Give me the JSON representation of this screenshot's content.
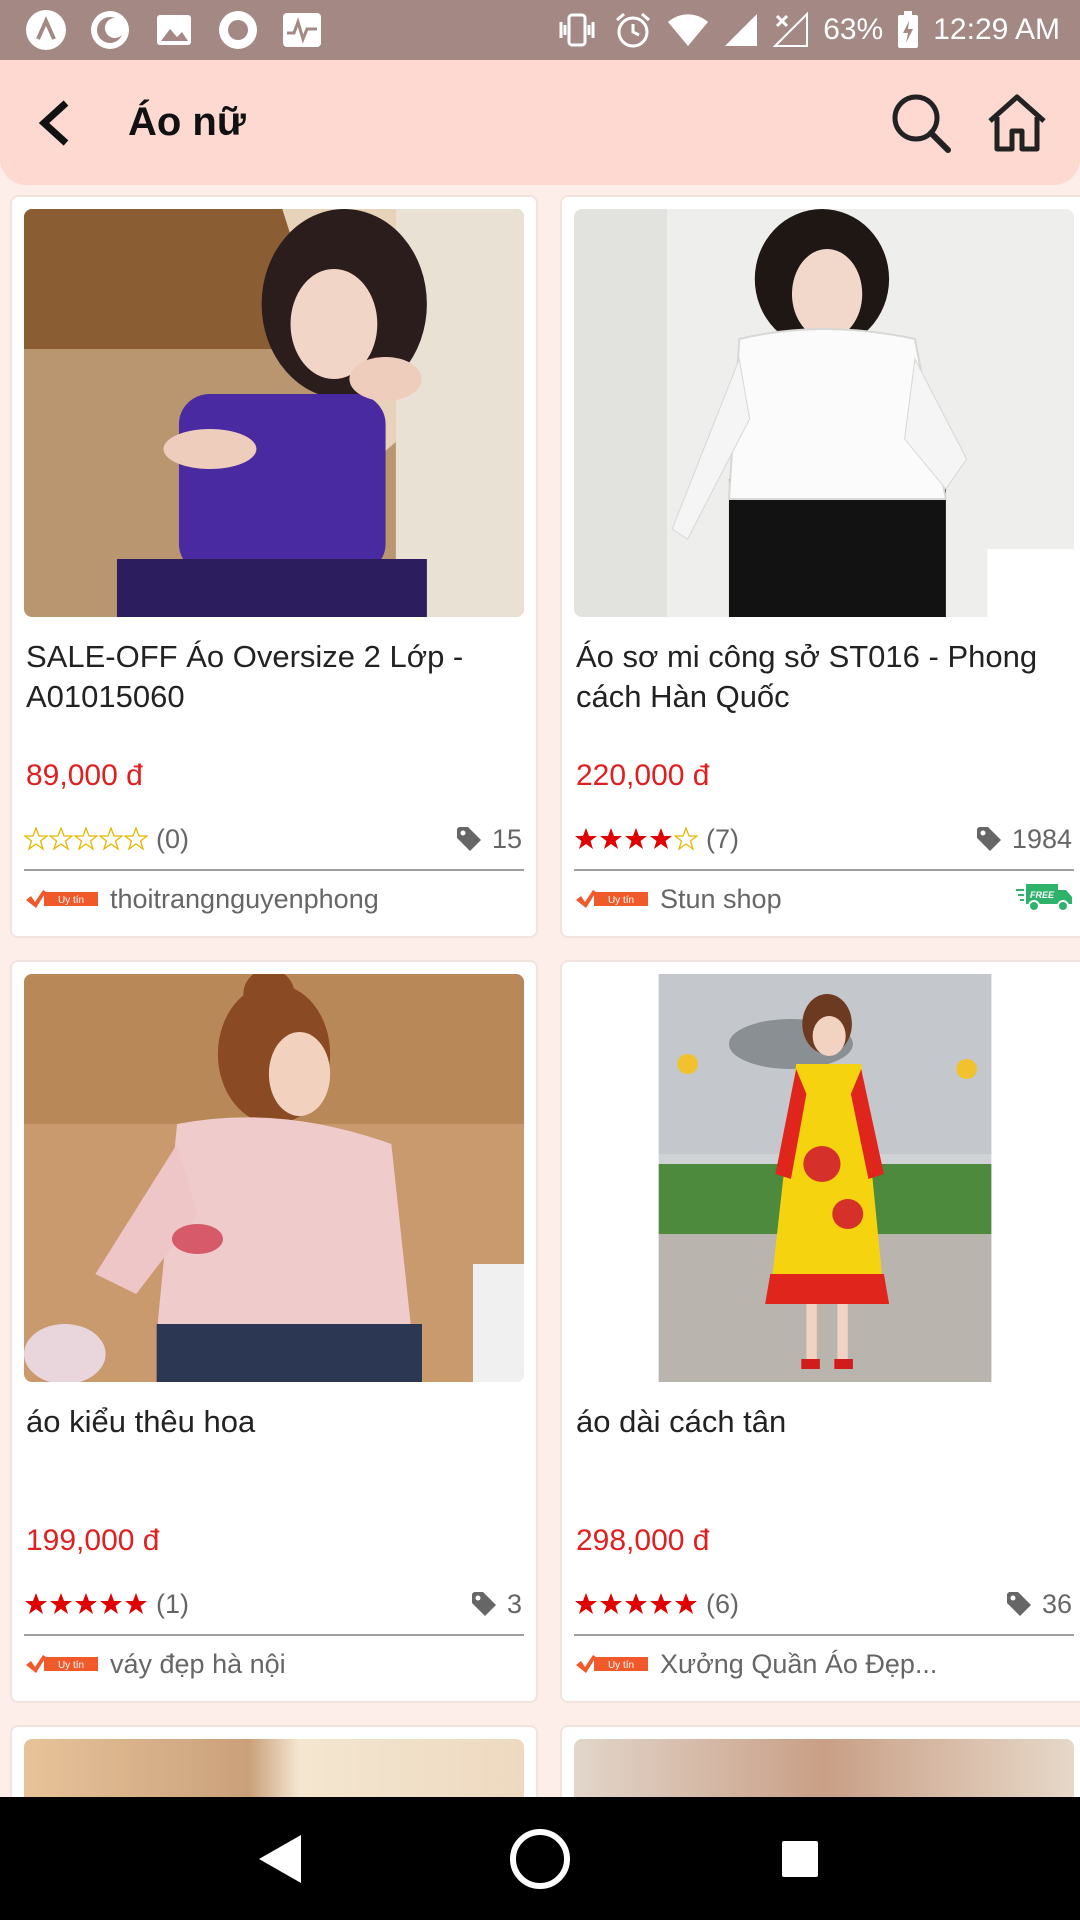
{
  "status_bar": {
    "battery": "63%",
    "time": "12:29 AM",
    "left_icons": [
      "app-icon",
      "moon-icon",
      "image-icon",
      "record-icon",
      "activity-icon"
    ]
  },
  "app_bar": {
    "title": "Áo nữ"
  },
  "products": [
    {
      "name": "SALE-OFF  Áo Oversize 2 Lớp - A01015060",
      "price": "89,000 đ",
      "rating": 0,
      "rating_count": "(0)",
      "sold": "15",
      "badge": "Uy tín",
      "shop": "thoitrangnguyenphong",
      "free_ship": false,
      "image": "woman-purple-top"
    },
    {
      "name": "Áo sơ mi công sở ST016 - Phong cách Hàn Quốc",
      "price": "220,000 đ",
      "rating": 4,
      "rating_count": "(7)",
      "sold": "1984",
      "badge": "Uy tín",
      "shop": "Stun shop",
      "free_ship": true,
      "free_ship_label": "FREE",
      "image": "woman-white-shirt"
    },
    {
      "name": "áo kiểu thêu hoa",
      "price": "199,000 đ",
      "rating": 5,
      "rating_count": "(1)",
      "sold": "3",
      "badge": "Uy tín",
      "shop": "váy đẹp hà nội",
      "free_ship": false,
      "image": "woman-pink-blouse"
    },
    {
      "name": "áo dài cách tân",
      "price": "298,000 đ",
      "rating": 5,
      "rating_count": "(6)",
      "sold": "36",
      "badge": "Uy tín",
      "shop": "Xưởng Quần Áo Đẹp...",
      "free_ship": false,
      "image": "woman-yellow-ao-dai"
    }
  ],
  "colors": {
    "status_bar": "#a38883",
    "app_bar": "#fdd9d2",
    "price": "#e02020",
    "star": "#e00000",
    "badge": "#f05a2a",
    "free_ship": "#2fb36b"
  }
}
